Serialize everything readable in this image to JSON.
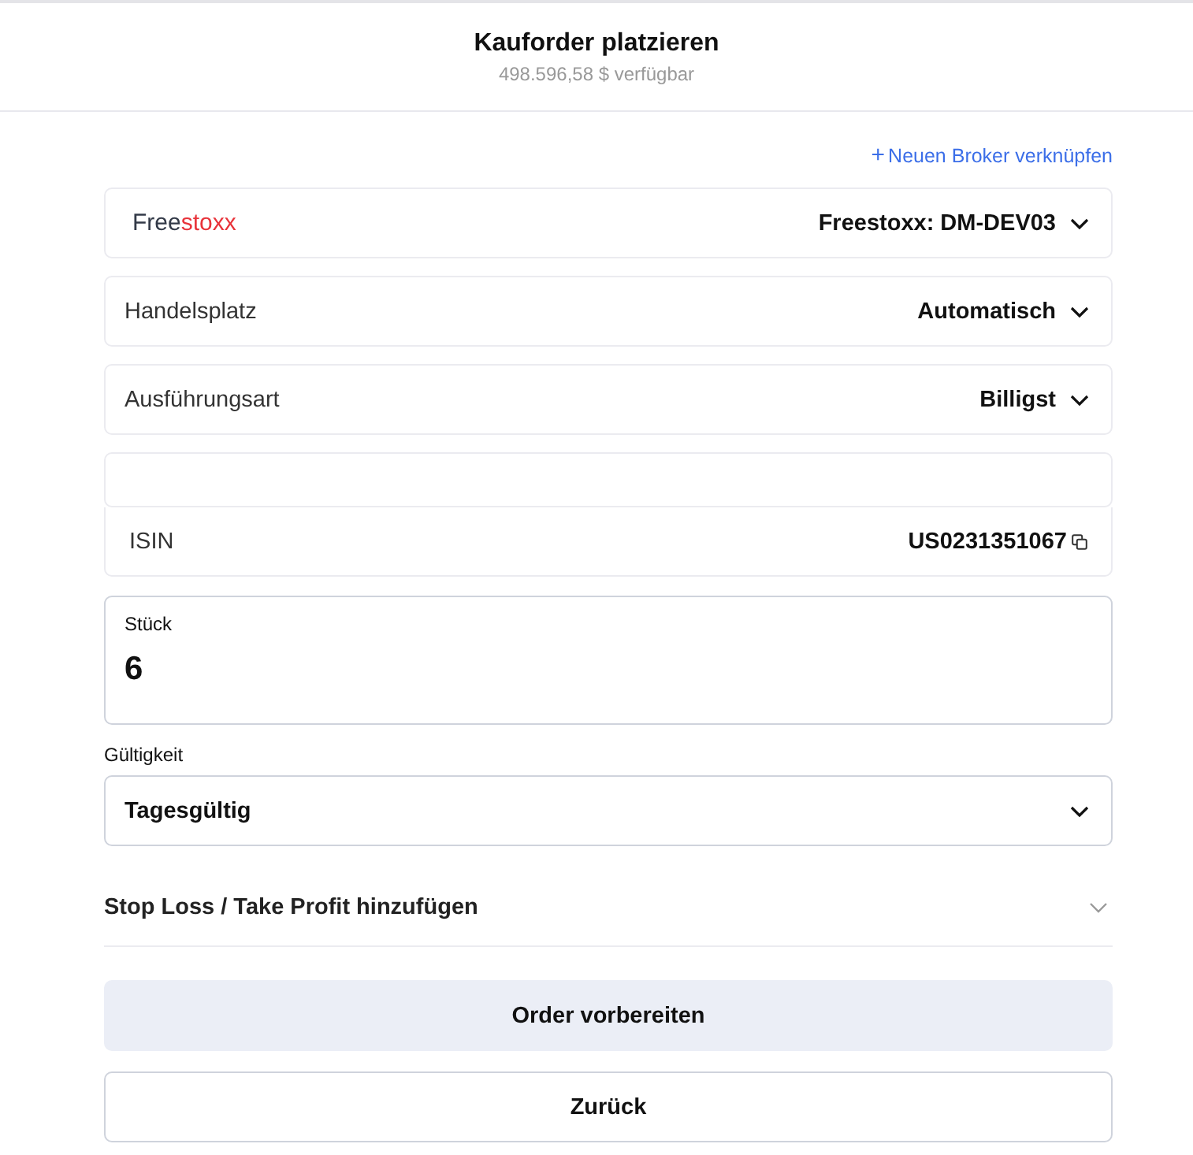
{
  "header": {
    "title": "Kauforder platzieren",
    "subtitle": "498.596,58 $ verfügbar"
  },
  "link": {
    "icon": "+",
    "label": "Neuen Broker verknüpfen"
  },
  "broker": {
    "logo_dark": "Free",
    "logo_accent": "stoxx",
    "value": "Freestoxx: DM-DEV03"
  },
  "selects": [
    {
      "label": "Handelsplatz",
      "value": "Automatisch"
    },
    {
      "label": "Ausführungsart",
      "value": "Billigst"
    }
  ],
  "isin": {
    "label": "ISIN",
    "value": "US0231351067"
  },
  "quantity": {
    "label": "Stück",
    "value": "6"
  },
  "validity": {
    "label": "Gültigkeit",
    "value": "Tagesgültig"
  },
  "stop_loss": {
    "label": "Stop Loss / Take Profit hinzufügen",
    "expanded": false
  },
  "buttons": [
    {
      "label": "Order vorbereiten",
      "kind": "primary"
    },
    {
      "label": "Zurück",
      "kind": "secondary"
    }
  ]
}
